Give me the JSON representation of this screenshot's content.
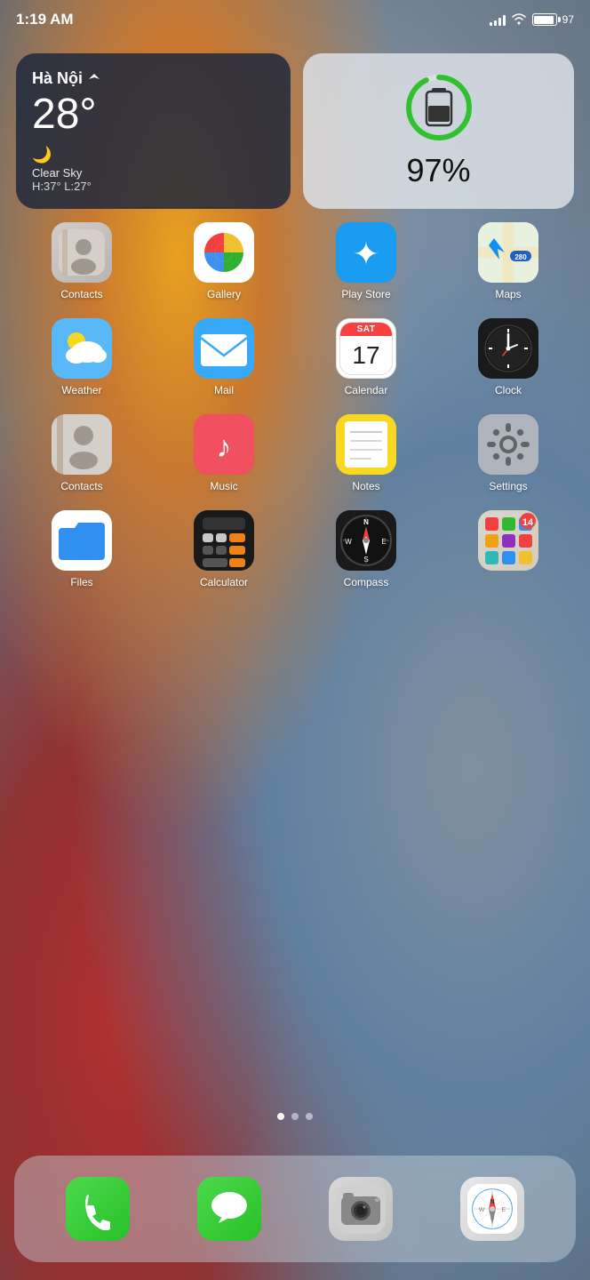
{
  "statusBar": {
    "time": "1:19 AM",
    "battery": "97",
    "batteryLabel": "97"
  },
  "widgets": {
    "weather": {
      "city": "Hà Nội",
      "temp": "28°",
      "description": "Clear Sky",
      "high": "H:37°",
      "low": "L:27°"
    },
    "battery": {
      "percent": "97%"
    }
  },
  "apps": {
    "row1": [
      {
        "label": "Contacts",
        "icon": "contacts"
      },
      {
        "label": "Gallery",
        "icon": "gallery"
      },
      {
        "label": "Play Store",
        "icon": "playstore"
      },
      {
        "label": "Maps",
        "icon": "maps"
      }
    ],
    "row2": [
      {
        "label": "Weather",
        "icon": "weather"
      },
      {
        "label": "Mail",
        "icon": "mail"
      },
      {
        "label": "Calendar",
        "icon": "calendar",
        "calDay": "17",
        "calMonth": "SAT"
      },
      {
        "label": "Clock",
        "icon": "clock"
      }
    ],
    "row3": [
      {
        "label": "Contacts",
        "icon": "contacts2"
      },
      {
        "label": "Music",
        "icon": "music"
      },
      {
        "label": "Notes",
        "icon": "notes"
      },
      {
        "label": "Settings",
        "icon": "settings"
      }
    ],
    "row4": [
      {
        "label": "Files",
        "icon": "files"
      },
      {
        "label": "Calculator",
        "icon": "calculator"
      },
      {
        "label": "Compass",
        "icon": "compass"
      },
      {
        "label": "",
        "icon": "folder"
      }
    ]
  },
  "dock": [
    {
      "label": "Phone",
      "icon": "phone"
    },
    {
      "label": "Messages",
      "icon": "messages"
    },
    {
      "label": "Camera",
      "icon": "camera"
    },
    {
      "label": "Safari",
      "icon": "safari"
    }
  ],
  "pageDots": [
    {
      "active": true
    },
    {
      "active": false
    },
    {
      "active": false
    }
  ]
}
